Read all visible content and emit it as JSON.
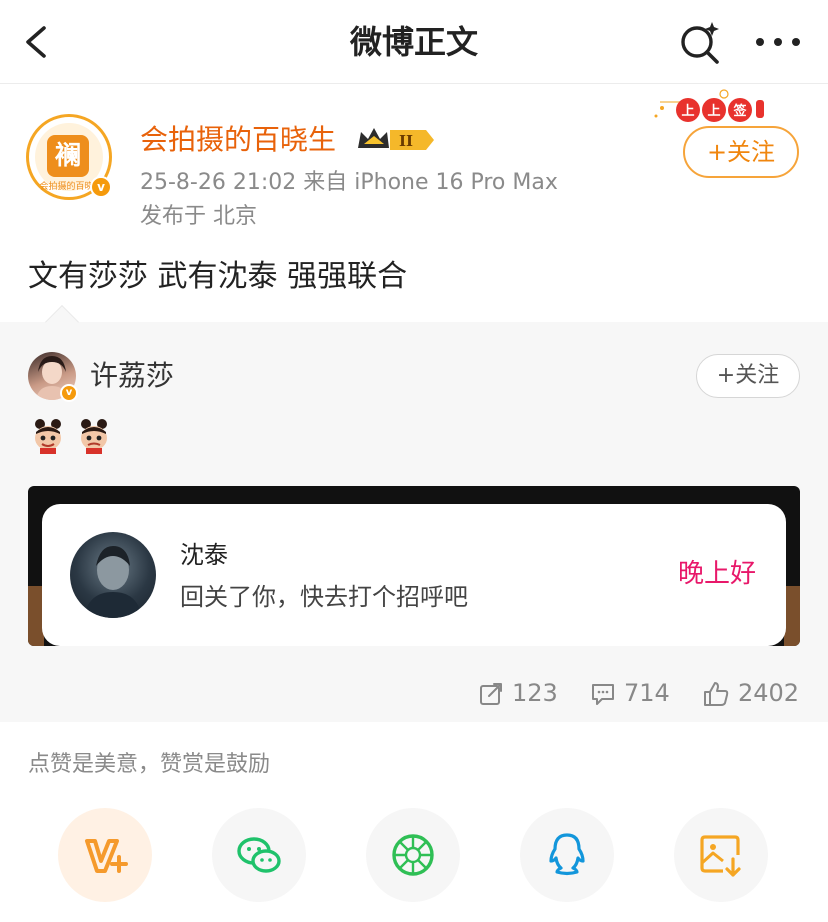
{
  "nav": {
    "title": "微博正文",
    "back_icon": "chevron-left-icon",
    "search_icon": "search-sparkle-icon",
    "more_icon": "more-dots-icon"
  },
  "post": {
    "author": "会拍摄的百晓生",
    "avatar_logo_char": "襕",
    "avatar_logo_text": "会拍摄的百晓生",
    "verified": "v",
    "meta": "25-8-26 21:02  来自 iPhone 16 Pro Max",
    "location": "发布于 北京",
    "follow_label": "+关注",
    "festive_badge_text": "上上签",
    "text": "文有莎莎 武有沈泰 强强联合"
  },
  "repost": {
    "author": "许荔莎",
    "follow_label": "+关注",
    "emoji_count": 2,
    "card": {
      "name": "沈泰",
      "desc": "回关了你，快去打个招呼吧",
      "greeting": "晚上好"
    },
    "stats": {
      "reposts": "123",
      "comments": "714",
      "likes": "2402"
    }
  },
  "reward_text": "点赞是美意，赞赏是鼓励",
  "share_items": [
    {
      "name": "vip-reward",
      "icon": "v-plus-icon",
      "color": "#f59a2c"
    },
    {
      "name": "wechat",
      "icon": "wechat-icon",
      "color": "#1fc26b"
    },
    {
      "name": "moments",
      "icon": "aperture-icon",
      "color": "#2fbf55"
    },
    {
      "name": "qq",
      "icon": "qq-penguin-icon",
      "color": "#1296db"
    },
    {
      "name": "save-image",
      "icon": "image-download-icon",
      "color": "#f5a623"
    }
  ],
  "colors": {
    "accent_orange": "#e8620a",
    "follow_orange": "#f0860e",
    "greeting_pink": "#e8186a"
  }
}
